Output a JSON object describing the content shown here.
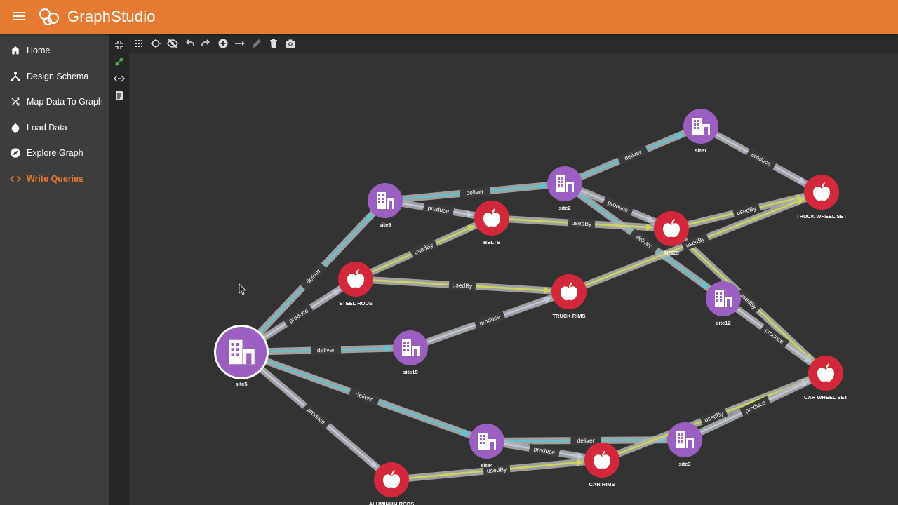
{
  "app": {
    "title": "GraphStudio"
  },
  "nav": {
    "items": [
      {
        "label": "Home",
        "icon": "home-icon"
      },
      {
        "label": "Design Schema",
        "icon": "schema-icon"
      },
      {
        "label": "Map Data To Graph",
        "icon": "shuffle-icon"
      },
      {
        "label": "Load Data",
        "icon": "drop-icon"
      },
      {
        "label": "Explore Graph",
        "icon": "compass-icon"
      },
      {
        "label": "Write Queries",
        "icon": "code-icon",
        "active": true
      }
    ]
  },
  "colors": {
    "accent": "#e67a32",
    "vertex_site": "#9a5fc0",
    "vertex_product": "#d3283b",
    "edge_base": "#b4b4b4",
    "edge_deliver": "#5cc6d6",
    "edge_produce": "#c0c8e0",
    "edge_usedby": "#cdd65a"
  },
  "graph": {
    "vertices": [
      {
        "id": "site1",
        "type": "site",
        "label": "site1"
      },
      {
        "id": "site2",
        "type": "site",
        "label": "site2"
      },
      {
        "id": "site9",
        "type": "site",
        "label": "site9"
      },
      {
        "id": "site12",
        "type": "site",
        "label": "site12"
      },
      {
        "id": "site15",
        "type": "site",
        "label": "site15"
      },
      {
        "id": "site5",
        "type": "site",
        "label": "site5",
        "selected": true
      },
      {
        "id": "site4",
        "type": "site",
        "label": "site4"
      },
      {
        "id": "site3",
        "type": "site",
        "label": "site3"
      },
      {
        "id": "truckwheelset",
        "type": "product",
        "label": "TRUCK WHEEL SET"
      },
      {
        "id": "belts",
        "type": "product",
        "label": "BELTS"
      },
      {
        "id": "tires",
        "type": "product",
        "label": "TIRES"
      },
      {
        "id": "steelrods",
        "type": "product",
        "label": "STEEL RODS"
      },
      {
        "id": "truckrims",
        "type": "product",
        "label": "TRUCK RIMS"
      },
      {
        "id": "carwheelset",
        "type": "product",
        "label": "CAR WHEEL SET"
      },
      {
        "id": "carrims",
        "type": "product",
        "label": "CAR RIMS"
      },
      {
        "id": "aluminumrods",
        "type": "product",
        "label": "ALUMINUM RODS"
      }
    ],
    "edges": [
      {
        "from": "site2",
        "to": "site1",
        "label": "deliver",
        "type": "deliver"
      },
      {
        "from": "site1",
        "to": "truckwheelset",
        "label": "produce",
        "type": "produce"
      },
      {
        "from": "site9",
        "to": "site2",
        "label": "deliver",
        "type": "deliver"
      },
      {
        "from": "site9",
        "to": "belts",
        "label": "produce",
        "type": "produce"
      },
      {
        "from": "site2",
        "to": "tires",
        "label": "produce",
        "type": "produce"
      },
      {
        "from": "site2",
        "to": "site12",
        "label": "deliver",
        "type": "deliver"
      },
      {
        "from": "belts",
        "to": "tires",
        "label": "usedBy",
        "type": "usedBy"
      },
      {
        "from": "tires",
        "to": "truckwheelset",
        "label": "usedBy",
        "type": "usedBy"
      },
      {
        "from": "truckrims",
        "to": "truckwheelset",
        "label": "usedBy",
        "type": "usedBy"
      },
      {
        "from": "tires",
        "to": "carwheelset",
        "label": "usedBy",
        "type": "usedBy"
      },
      {
        "from": "site12",
        "to": "carwheelset",
        "label": "produce",
        "type": "produce"
      },
      {
        "from": "steelrods",
        "to": "belts",
        "label": "usedBy",
        "type": "usedBy"
      },
      {
        "from": "steelrods",
        "to": "truckrims",
        "label": "usedBy",
        "type": "usedBy"
      },
      {
        "from": "site5",
        "to": "site9",
        "label": "deliver",
        "type": "deliver"
      },
      {
        "from": "site5",
        "to": "steelrods",
        "label": "produce",
        "type": "produce"
      },
      {
        "from": "site5",
        "to": "site15",
        "label": "deliver",
        "type": "deliver"
      },
      {
        "from": "site15",
        "to": "truckrims",
        "label": "produce",
        "type": "produce"
      },
      {
        "from": "site5",
        "to": "site4",
        "label": "deliver",
        "type": "deliver"
      },
      {
        "from": "site5",
        "to": "aluminumrods",
        "label": "produce",
        "type": "produce"
      },
      {
        "from": "site4",
        "to": "site3",
        "label": "deliver",
        "type": "deliver"
      },
      {
        "from": "site4",
        "to": "carrims",
        "label": "produce",
        "type": "produce"
      },
      {
        "from": "aluminumrods",
        "to": "carrims",
        "label": "usedBy",
        "type": "usedBy"
      },
      {
        "from": "carrims",
        "to": "carwheelset",
        "label": "usedBy",
        "type": "usedBy"
      },
      {
        "from": "site3",
        "to": "carwheelset",
        "label": "produce",
        "type": "produce"
      }
    ]
  }
}
